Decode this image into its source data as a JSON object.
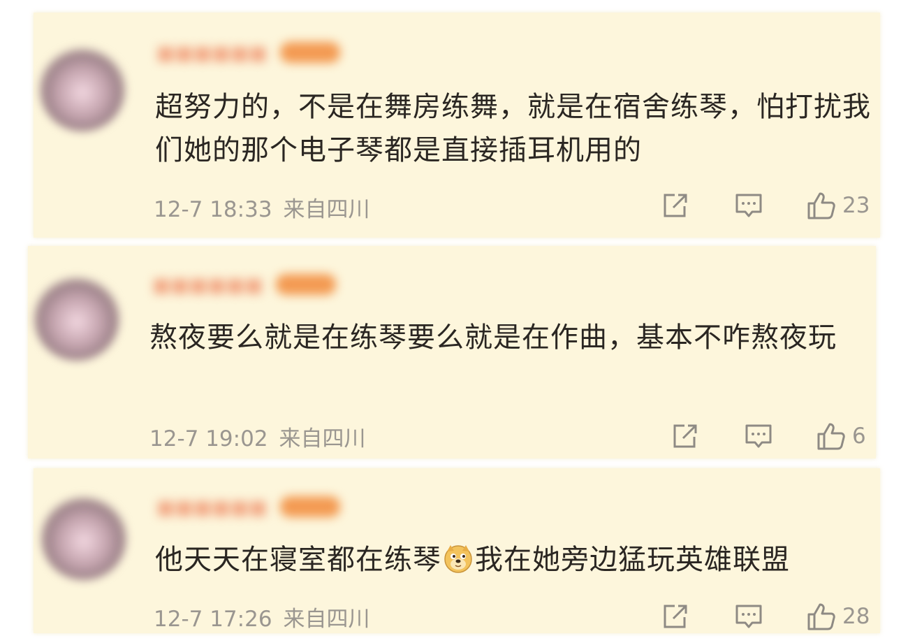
{
  "comments": [
    {
      "text": "超努力的，不是在舞房练舞，就是在宿舍练琴，怕打扰我们她的那个电子琴都是直接插耳机用的",
      "time": "12-7 18:33",
      "location": "来自四川",
      "likes": "23"
    },
    {
      "text": "熬夜要么就是在练琴要么就是在作曲，基本不咋熬夜玩",
      "time": "12-7 19:02",
      "location": "来自四川",
      "likes": "6"
    },
    {
      "text_before_emoji": "他天天在寝室都在练琴",
      "emoji": "doge-emoji",
      "text_after_emoji": "我在她旁边猛玩英雄联盟",
      "time": "12-7 17:26",
      "location": "来自四川",
      "likes": "28"
    }
  ],
  "icons": {
    "share": "share-icon",
    "comment": "comment-icon",
    "like": "thumbs-up-icon"
  },
  "colors": {
    "card_background": "#fdf6dc",
    "text": "#2a2622",
    "meta": "#9a9690"
  }
}
